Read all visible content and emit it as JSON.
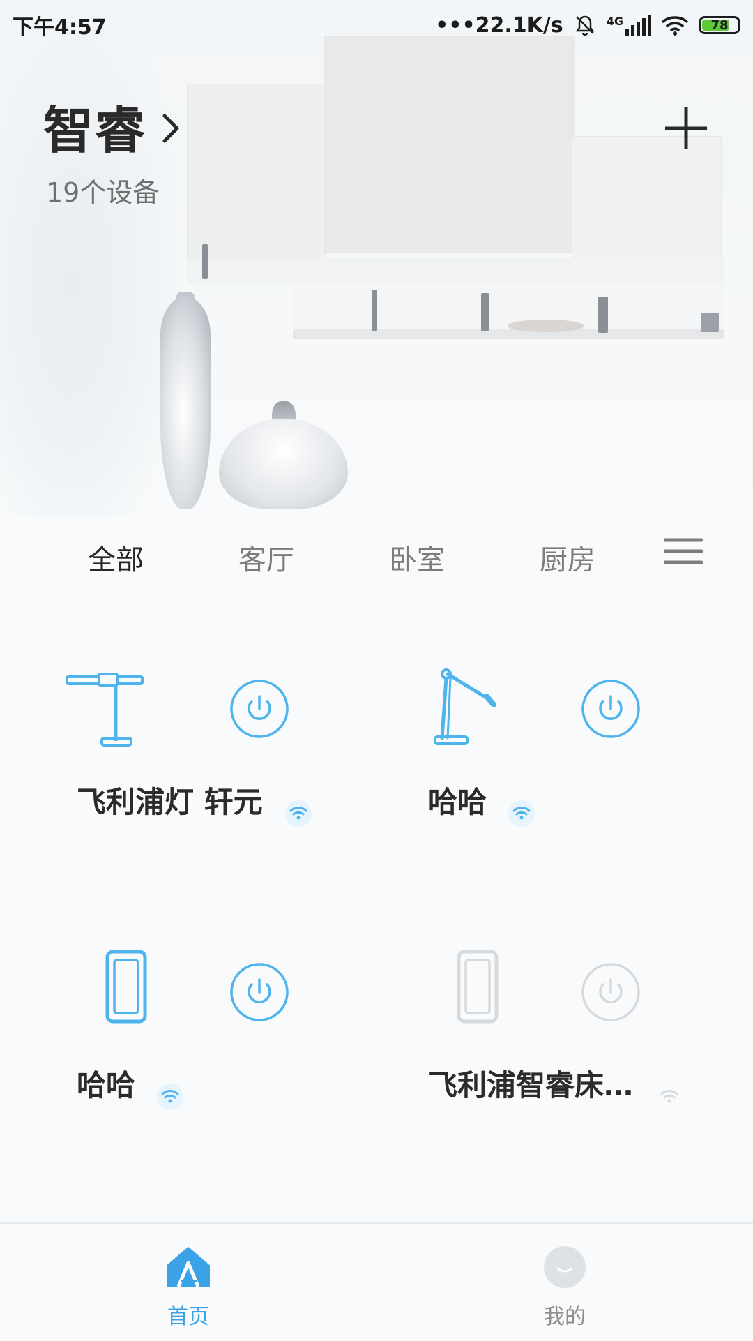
{
  "status_bar": {
    "time": "下午4:57",
    "network_speed": "•••22.1K/s",
    "network_type": "4G",
    "battery": "78",
    "icons": [
      "mute-bell-icon",
      "signal-icon",
      "wifi-icon",
      "battery-icon"
    ]
  },
  "header": {
    "home_name": "智睿",
    "device_count": "19个设备"
  },
  "tabs": [
    {
      "label": "全部",
      "active": true
    },
    {
      "label": "客厅",
      "active": false
    },
    {
      "label": "卧室",
      "active": false
    },
    {
      "label": "厨房",
      "active": false
    }
  ],
  "devices": [
    {
      "name": "飞利浦灯  轩元",
      "icon": "desk-lamp-bar-icon",
      "online": true
    },
    {
      "name": "哈哈",
      "icon": "desk-lamp-arm-icon",
      "online": true
    },
    {
      "name": "哈哈",
      "icon": "bedside-lamp-icon",
      "online": true
    },
    {
      "name": "飞利浦智睿床…",
      "icon": "bedside-lamp-icon",
      "online": false
    }
  ],
  "bottom_nav": [
    {
      "label": "首页",
      "icon": "home-icon",
      "active": true
    },
    {
      "label": "我的",
      "icon": "profile-icon",
      "active": false
    }
  ],
  "colors": {
    "accent": "#4fb4ec",
    "offline": "#d7dadd",
    "text_dark": "#2b2b2b",
    "text_muted": "#7c7c7c"
  }
}
